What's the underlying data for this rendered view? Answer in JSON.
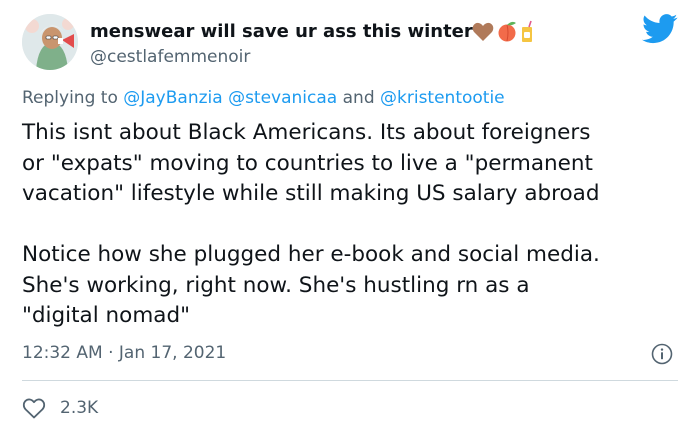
{
  "author": {
    "display_name": "menswear will save ur ass this winter",
    "handle": "@cestlafemmenoir",
    "name_emojis": [
      "brown-heart-icon",
      "peach-icon",
      "juice-box-icon"
    ]
  },
  "reply": {
    "prefix": "Replying to",
    "mention_1": "@JayBanzia",
    "mention_2": "@stevanicaa",
    "joiner": "and",
    "mention_3": "@kristentootie"
  },
  "body": {
    "lines": [
      "This isnt about Black Americans. Its about foreigners",
      "or \"expats\" moving to countries to live a \"permanent",
      "vacation\" lifestyle while still making US salary abroad",
      "",
      "Notice how she plugged her e-book and social media.",
      "She's working, right now. She's hustling rn as a",
      "\"digital nomad\""
    ]
  },
  "meta": {
    "timestamp": "12:32 AM · Jan 17, 2021"
  },
  "stats": {
    "likes": "2.3K"
  },
  "colors": {
    "text": "#0f1419",
    "secondary": "#536471",
    "accent": "#1d9bf0",
    "divider": "#cfd9de"
  }
}
